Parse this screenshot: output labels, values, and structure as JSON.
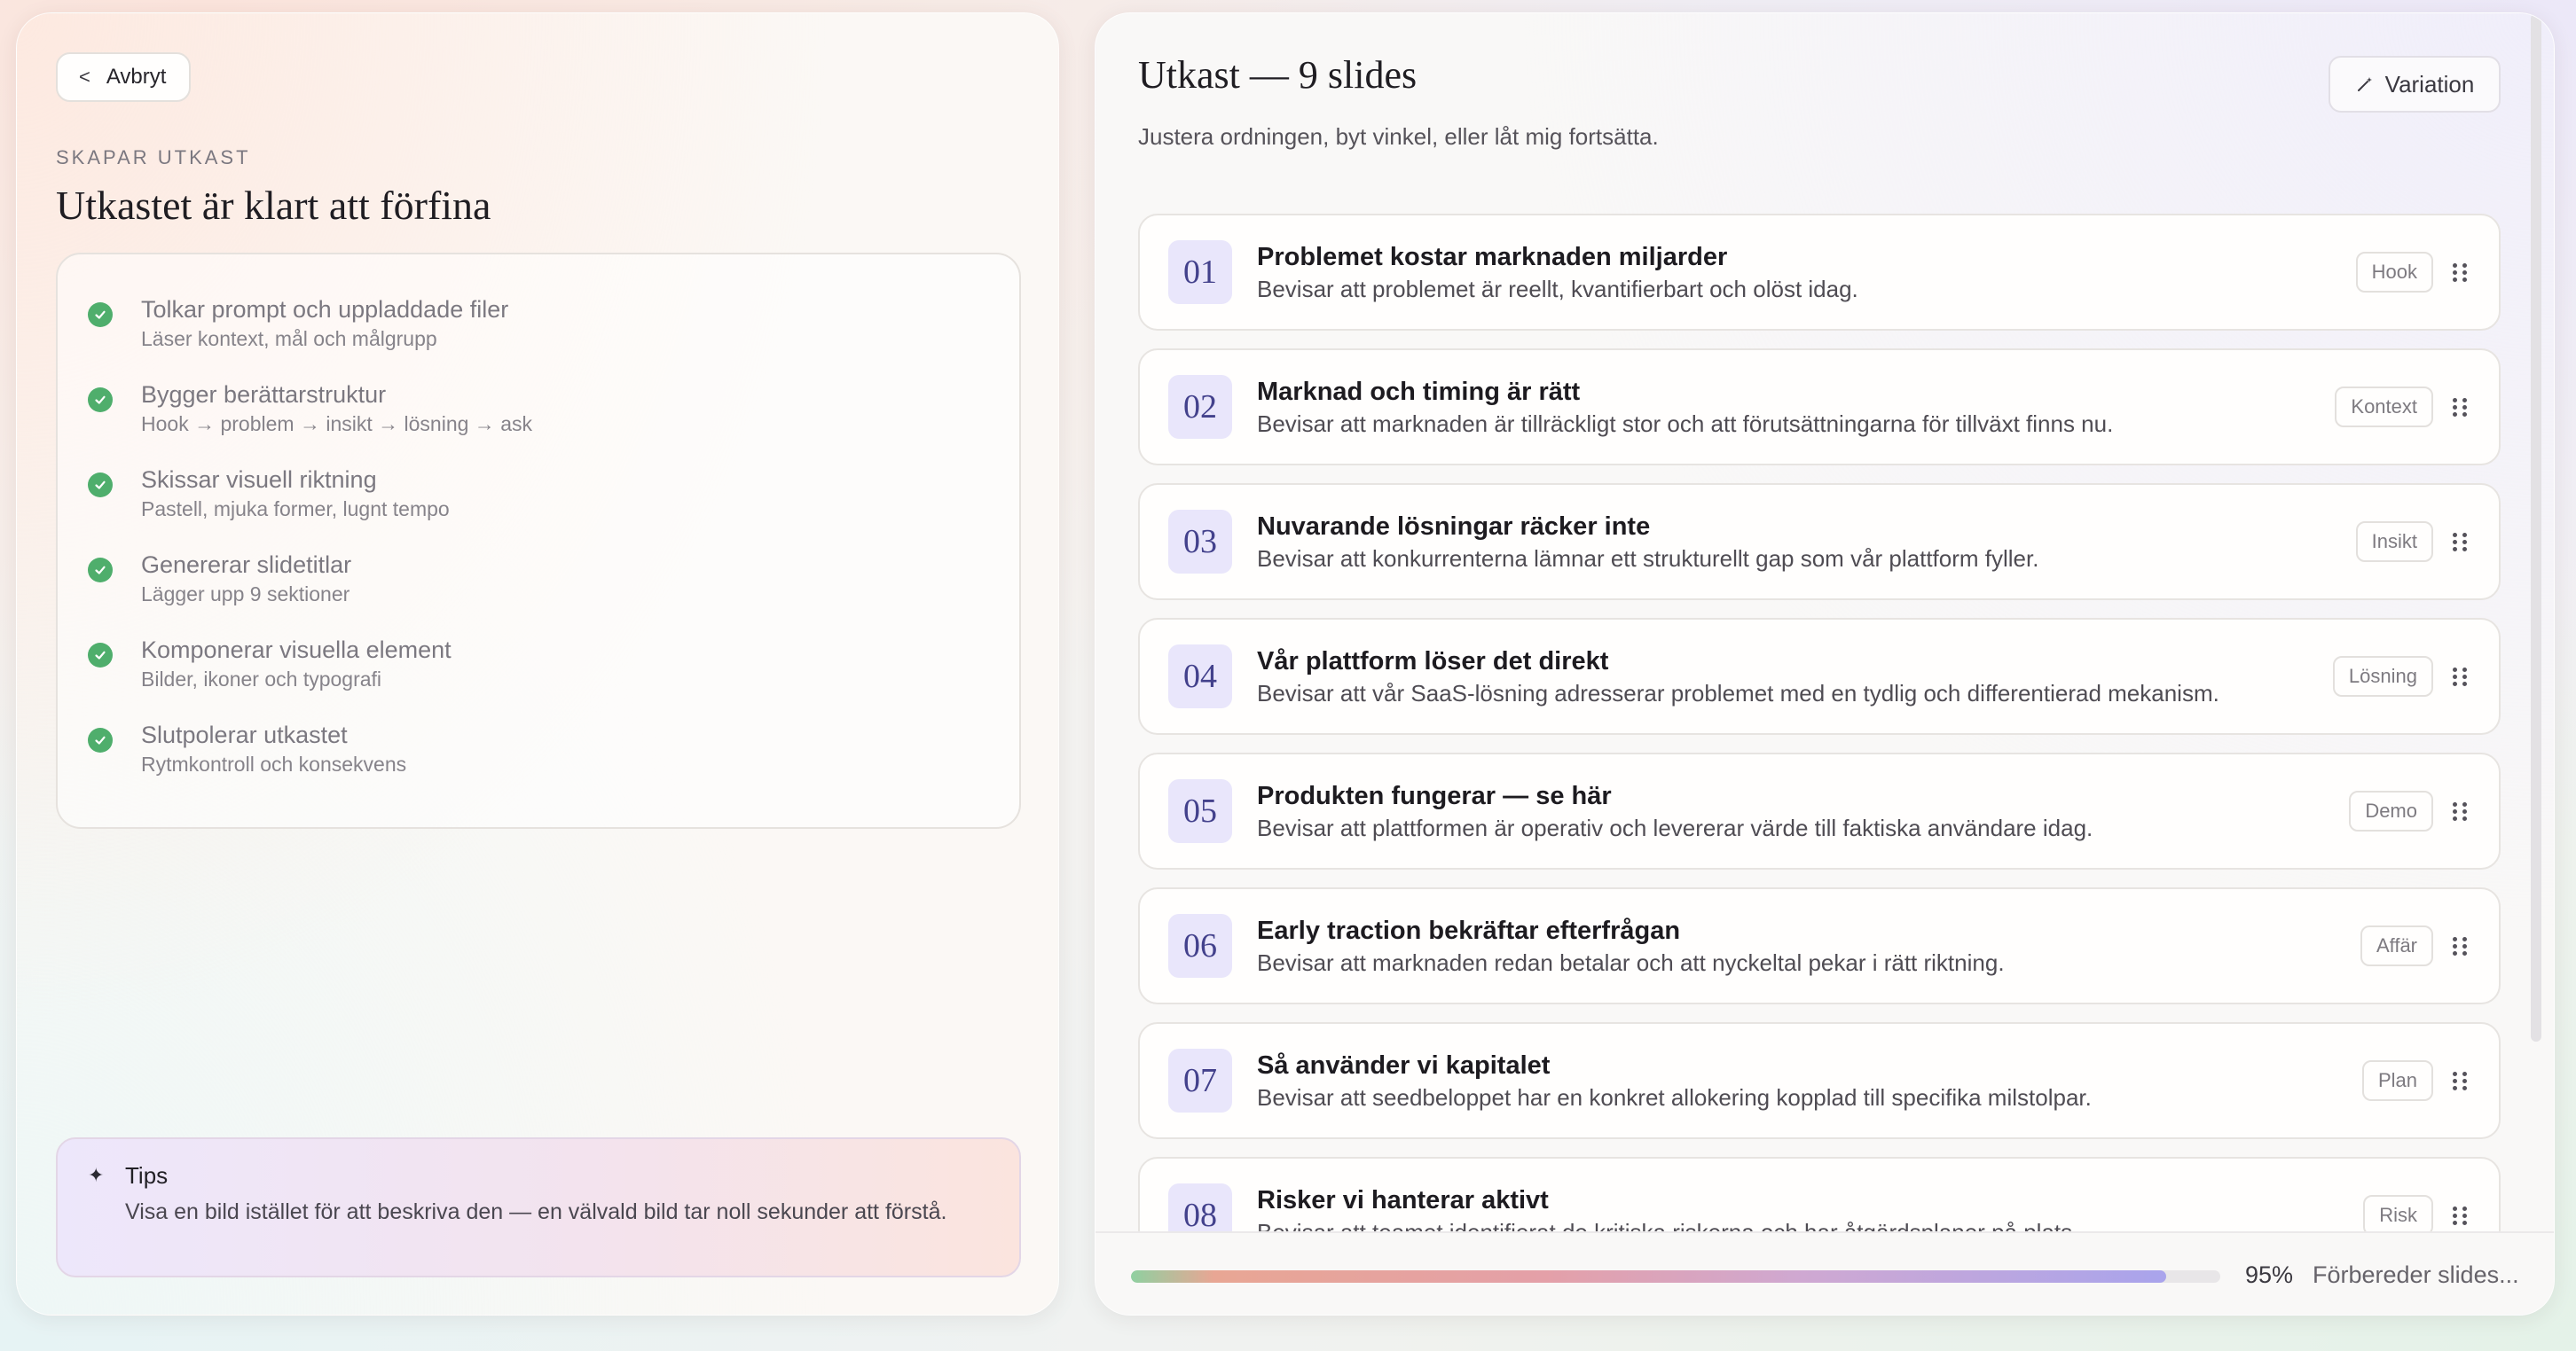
{
  "left": {
    "back_label": "Avbryt",
    "eyebrow": "SKAPAR UTKAST",
    "title": "Utkastet är klart att förfina",
    "steps": [
      {
        "title": "Tolkar prompt och uppladdade filer",
        "sub": "Läser kontext, mål och målgrupp"
      },
      {
        "title": "Bygger berättarstruktur",
        "sub": "Hook → problem → insikt → lösning → ask"
      },
      {
        "title": "Skissar visuell riktning",
        "sub": "Pastell, mjuka former, lugnt tempo"
      },
      {
        "title": "Genererar slidetitlar",
        "sub": "Lägger upp 9 sektioner"
      },
      {
        "title": "Komponerar visuella element",
        "sub": "Bilder, ikoner och typografi"
      },
      {
        "title": "Slutpolerar utkastet",
        "sub": "Rytmkontroll och konsekvens"
      }
    ],
    "tips": {
      "title": "Tips",
      "text": "Visa en bild istället för att beskriva den — en välvald bild tar noll sekunder att förstå."
    }
  },
  "right": {
    "title": "Utkast — 9 slides",
    "subtitle": "Justera ordningen, byt vinkel, eller låt mig fortsätta.",
    "variation_label": "Variation",
    "slides": [
      {
        "num": "01",
        "title": "Problemet kostar marknaden miljarder",
        "desc": "Bevisar att problemet är reellt, kvantifierbart och olöst idag.",
        "tag": "Hook"
      },
      {
        "num": "02",
        "title": "Marknad och timing är rätt",
        "desc": "Bevisar att marknaden är tillräckligt stor och att förutsättningarna för tillväxt finns nu.",
        "tag": "Kontext"
      },
      {
        "num": "03",
        "title": "Nuvarande lösningar räcker inte",
        "desc": "Bevisar att konkurrenterna lämnar ett strukturellt gap som vår plattform fyller.",
        "tag": "Insikt"
      },
      {
        "num": "04",
        "title": "Vår plattform löser det direkt",
        "desc": "Bevisar att vår SaaS-lösning adresserar problemet med en tydlig och differentierad mekanism.",
        "tag": "Lösning"
      },
      {
        "num": "05",
        "title": "Produkten fungerar — se här",
        "desc": "Bevisar att plattformen är operativ och levererar värde till faktiska användare idag.",
        "tag": "Demo"
      },
      {
        "num": "06",
        "title": "Early traction bekräftar efterfrågan",
        "desc": "Bevisar att marknaden redan betalar och att nyckeltal pekar i rätt riktning.",
        "tag": "Affär"
      },
      {
        "num": "07",
        "title": "Så använder vi kapitalet",
        "desc": "Bevisar att seedbeloppet har en konkret allokering kopplad till specifika milstolpar.",
        "tag": "Plan"
      },
      {
        "num": "08",
        "title": "Risker vi hanterar aktivt",
        "desc": "Bevisar att teamet identifierat de kritiska riskerna och har åtgärdsplaner på plats.",
        "tag": "Risk"
      }
    ],
    "progress": {
      "percent": 95,
      "percent_label": "95%",
      "status": "Förbereder slides..."
    }
  }
}
